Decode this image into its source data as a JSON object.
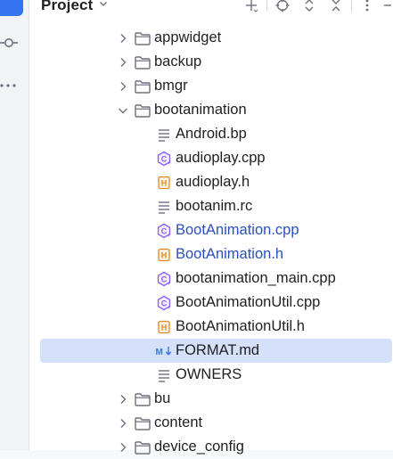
{
  "panel": {
    "title": "Project"
  },
  "toolbar": {
    "icons": [
      "add-icon",
      "locate-icon",
      "expand-all-icon",
      "collapse-all-icon",
      "more-options-icon"
    ]
  },
  "tree": [
    {
      "label": "appwidget",
      "kind": "folder",
      "expanded": false,
      "indent": 1
    },
    {
      "label": "backup",
      "kind": "folder",
      "expanded": false,
      "indent": 1
    },
    {
      "label": "bmgr",
      "kind": "folder",
      "expanded": false,
      "indent": 1
    },
    {
      "label": "bootanimation",
      "kind": "folder",
      "expanded": true,
      "indent": 1
    },
    {
      "label": "Android.bp",
      "kind": "text",
      "indent": 2
    },
    {
      "label": "audioplay.cpp",
      "kind": "cpp",
      "indent": 2
    },
    {
      "label": "audioplay.h",
      "kind": "h",
      "indent": 2
    },
    {
      "label": "bootanim.rc",
      "kind": "text",
      "indent": 2
    },
    {
      "label": "BootAnimation.cpp",
      "kind": "cpp",
      "indent": 2,
      "modified": true
    },
    {
      "label": "BootAnimation.h",
      "kind": "h",
      "indent": 2,
      "modified": true
    },
    {
      "label": "bootanimation_main.cpp",
      "kind": "cpp",
      "indent": 2
    },
    {
      "label": "BootAnimationUtil.cpp",
      "kind": "cpp",
      "indent": 2
    },
    {
      "label": "BootAnimationUtil.h",
      "kind": "h",
      "indent": 2
    },
    {
      "label": "FORMAT.md",
      "kind": "md",
      "indent": 2,
      "selected": true
    },
    {
      "label": "OWNERS",
      "kind": "text",
      "indent": 2
    },
    {
      "label": "bu",
      "kind": "folder",
      "expanded": false,
      "indent": 1
    },
    {
      "label": "content",
      "kind": "folder",
      "expanded": false,
      "indent": 1
    },
    {
      "label": "device_config",
      "kind": "folder",
      "expanded": false,
      "indent": 1
    }
  ],
  "colors": {
    "accent": "#3574f0",
    "selection": "#d5e1fb",
    "modified_text": "#2a4fbf",
    "cpp_icon": "#8a5cf6",
    "h_icon": "#e08a1e"
  }
}
